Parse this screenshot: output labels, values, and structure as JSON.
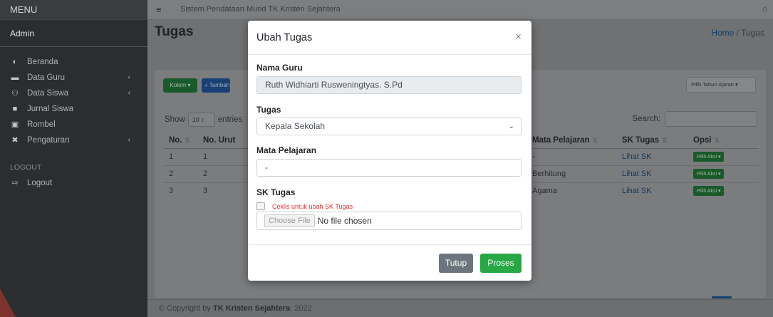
{
  "sidebar": {
    "menu_title": "MENU",
    "user": "Admin",
    "items": [
      {
        "label": "Beranda",
        "icon": "dashboard-icon",
        "glyph": "◐",
        "chevron": ""
      },
      {
        "label": "Data Guru",
        "icon": "teacher-icon",
        "glyph": "▬",
        "chevron": "‹"
      },
      {
        "label": "Data Siswa",
        "icon": "users-icon",
        "glyph": "⚇",
        "chevron": "‹"
      },
      {
        "label": "Jurnal Siswa",
        "icon": "file-icon",
        "glyph": "■",
        "chevron": ""
      },
      {
        "label": "Rombel",
        "icon": "building-icon",
        "glyph": "▣",
        "chevron": ""
      },
      {
        "label": "Pengaturan",
        "icon": "tools-icon",
        "glyph": "✖",
        "chevron": "‹"
      }
    ],
    "logout_header": "LOGOUT",
    "logout_label": "Logout",
    "logout_glyph": "⇨"
  },
  "topbar": {
    "menu_glyph": "≡",
    "app_title": "Sistem Pendataan Murid TK Kristen Sejahtera",
    "user_glyph": "⌂"
  },
  "page": {
    "title": "Tugas",
    "breadcrumb_home": "Home",
    "breadcrumb_sep": " / ",
    "breadcrumb_current": "Tugas"
  },
  "toolbar": {
    "kolom_label": "Kolom ▾",
    "tambah_label": "+ Tambah",
    "tahun_label": "Pilih Tahun Ajaran ▾"
  },
  "table_controls": {
    "show_label": "Show",
    "length_value": "10 ↕",
    "entries_label": "entries",
    "search_label": "Search:"
  },
  "table": {
    "headers": [
      "No.",
      "No. Urut",
      "",
      "Mata Pelajaran",
      "SK Tugas",
      "Opsi"
    ],
    "sort_glyph": "⇅",
    "rows": [
      {
        "no": "1",
        "urut": "1",
        "mapel": "-",
        "sk": "Lihat SK",
        "opsi": "Pilih Aksi ▾"
      },
      {
        "no": "2",
        "urut": "2",
        "mapel": "Berhitung",
        "sk": "Lihat SK",
        "opsi": "Pilih Aksi ▾"
      },
      {
        "no": "3",
        "urut": "3",
        "mapel": "Agama",
        "sk": "Lihat SK",
        "opsi": "Pilih Aksi ▾"
      }
    ]
  },
  "footer": {
    "prefix": "© Copyright by ",
    "brand": "TK Kristen Sejahtera",
    "suffix": ". 2022"
  },
  "modal": {
    "title": "Ubah Tugas",
    "close_glyph": "×",
    "nama_label": "Nama Guru",
    "nama_value": "Ruth Widhiarti Rusweningtyas. S.Pd",
    "tugas_label": "Tugas",
    "tugas_value": "Kepala Sekolah",
    "select_caret": "⌄",
    "mapel_label": "Mata Pelajaran",
    "mapel_value": "-",
    "sk_label": "SK Tugas",
    "checkbox_label": "Ceklis untuk ubah SK Tugas",
    "file_button": "Choose File",
    "file_status": "No file chosen",
    "tutup_label": "Tutup",
    "proses_label": "Proses"
  },
  "colors": {
    "primary_blue": "#007bff",
    "success_green": "#28a745",
    "secondary_gray": "#6c757d",
    "danger_red": "#e03131"
  }
}
